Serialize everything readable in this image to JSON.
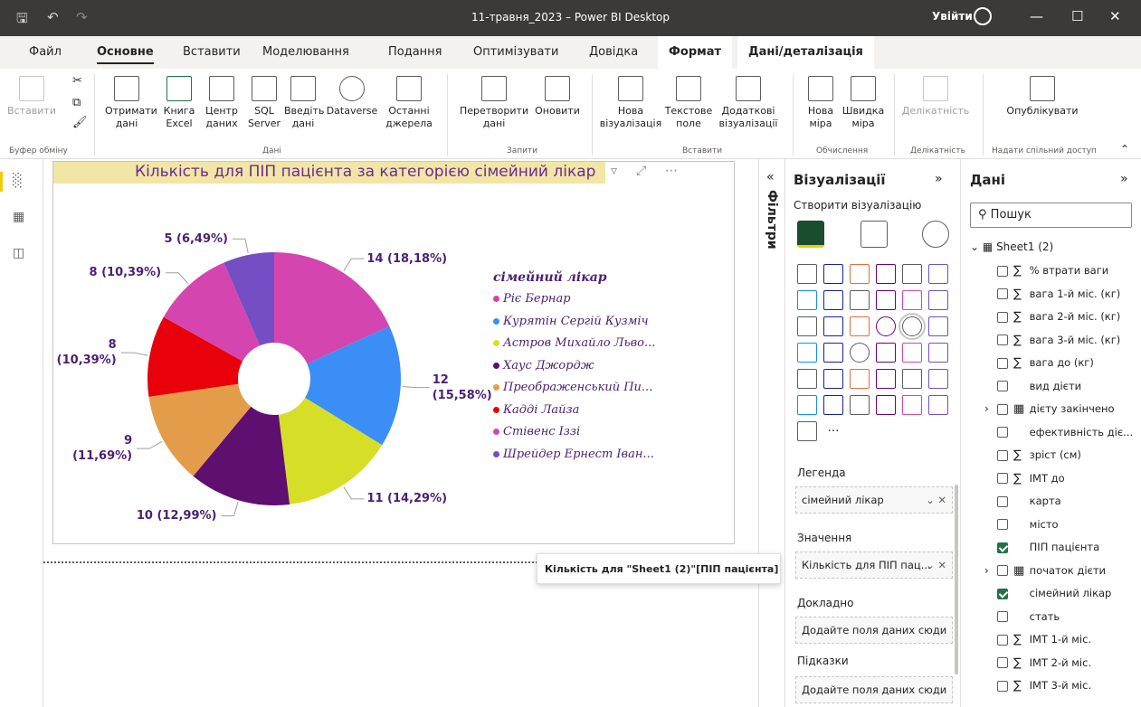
{
  "window": {
    "title": "11-травня_2023 – Power BI Desktop",
    "signin_label": "Увійти"
  },
  "menu": {
    "tabs": [
      "Файл",
      "Основне",
      "Вставити",
      "Моделювання",
      "Подання",
      "Оптимізувати",
      "Довідка",
      "Формат",
      "Дані/деталізація"
    ],
    "active_tab": "Основне"
  },
  "ribbon": {
    "buttons": {
      "paste": "Вставити",
      "get_data": "Отримати дані",
      "excel": "Книга Excel",
      "data_hub": "Центр даних",
      "sql": "SQL Server",
      "enter_data": "Введіть дані",
      "dataverse": "Dataverse",
      "recent": "Останні джерела",
      "transform": "Перетворити дані",
      "refresh": "Оновити",
      "new_visual": "Нова візуалізація",
      "textbox": "Текстове поле",
      "more_visuals": "Додаткові візуалізації",
      "new_measure": "Нова міра",
      "quick_measure": "Швидка міра",
      "sensitivity": "Делікатність",
      "publish": "Опублікувати"
    },
    "groups": {
      "clipboard": "Буфер обміну",
      "data": "Дані",
      "queries": "Запити",
      "insert": "Вставити",
      "calculations": "Обчислення",
      "sensitivity": "Делікатність",
      "share": "Надати спільний доступ"
    }
  },
  "visual": {
    "title": "Кількість для ПІП пацієнта за категорією сімейний лікар",
    "tooltip": "Кількість для \"Sheet1 (2)\"[ПІП пацієнта]"
  },
  "chart_data": {
    "type": "pie",
    "title": "Кількість для ПІП пацієнта за категорією сімейний лікар",
    "legend_title": "сімейний лікар",
    "legend_position": "right",
    "categories": [
      "Ріє Бернар",
      "Курятін Сергій Кузміч",
      "Астров Михайло Льво...",
      "Хаус Джордж",
      "Преображенський Пи...",
      "Кадді Лайза",
      "Стівенс Іззі",
      "Шрейдер Ернест Іван..."
    ],
    "values": [
      14,
      12,
      11,
      10,
      9,
      8,
      8,
      5
    ],
    "labels": [
      "14 (18,18%)",
      "12 (15,58%)",
      "11 (14,29%)",
      "10 (12,99%)",
      "9 (11,69%)",
      "8 (10,39%)",
      "8 (10,39%)",
      "5 (6,49%)"
    ],
    "label_lines": [
      [
        "14 (18,18%)"
      ],
      [
        "12",
        "(15,58%)"
      ],
      [
        "11 (14,29%)"
      ],
      [
        "10 (12,99%)"
      ],
      [
        "9",
        "(11,69%)"
      ],
      [
        "8",
        "(10,39%)"
      ],
      [
        "8 (10,39%)"
      ],
      [
        "5 (6,49%)"
      ]
    ],
    "colors": [
      "#d445b0",
      "#3a8ef6",
      "#d7de28",
      "#5f0f6f",
      "#e39d4a",
      "#e8000b",
      "#d445b0",
      "#744ec2"
    ]
  },
  "filters_label": "Фільтри",
  "viz_pane": {
    "title": "Візуалізації",
    "build_label": "Створити візуалізацію",
    "wells": [
      {
        "header": "Легенда",
        "value": "сімейний лікар"
      },
      {
        "header": "Значення",
        "value": "Кількість для ПІП пац..."
      },
      {
        "header": "Докладно",
        "value": "Додайте поля даних сюди"
      },
      {
        "header": "Підказки",
        "value": "Додайте поля даних сюди"
      }
    ]
  },
  "data_pane": {
    "title": "Дані",
    "search_placeholder": "Пошук",
    "table_name": "Sheet1 (2)",
    "fields": [
      {
        "name": "% втрати ваги",
        "sigma": true,
        "checked": false
      },
      {
        "name": "вага 1-й міс. (кг)",
        "sigma": true,
        "checked": false
      },
      {
        "name": "вага 2-й міс. (кг)",
        "sigma": true,
        "checked": false
      },
      {
        "name": "вага 3-й міс. (кг)",
        "sigma": true,
        "checked": false
      },
      {
        "name": "вага до (кг)",
        "sigma": true,
        "checked": false
      },
      {
        "name": "вид дієти",
        "sigma": false,
        "checked": false
      },
      {
        "name": "дієту закінчено",
        "sigma": false,
        "checked": false,
        "date": true
      },
      {
        "name": "ефективність діє...",
        "sigma": false,
        "checked": false
      },
      {
        "name": "зріст (см)",
        "sigma": true,
        "checked": false
      },
      {
        "name": "ІМТ до",
        "sigma": true,
        "checked": false
      },
      {
        "name": "карта",
        "sigma": false,
        "checked": false
      },
      {
        "name": "місто",
        "sigma": false,
        "checked": false
      },
      {
        "name": "ПІП пацієнта",
        "sigma": false,
        "checked": true
      },
      {
        "name": "початок дієти",
        "sigma": false,
        "checked": false,
        "date": true
      },
      {
        "name": "сімейний лікар",
        "sigma": false,
        "checked": true
      },
      {
        "name": "стать",
        "sigma": false,
        "checked": false
      },
      {
        "name": "ІМТ 1-й міс.",
        "sigma": true,
        "checked": false
      },
      {
        "name": "ІМТ 2-й міс.",
        "sigma": true,
        "checked": false
      },
      {
        "name": "ІМТ 3-й міс.",
        "sigma": true,
        "checked": false
      }
    ]
  }
}
